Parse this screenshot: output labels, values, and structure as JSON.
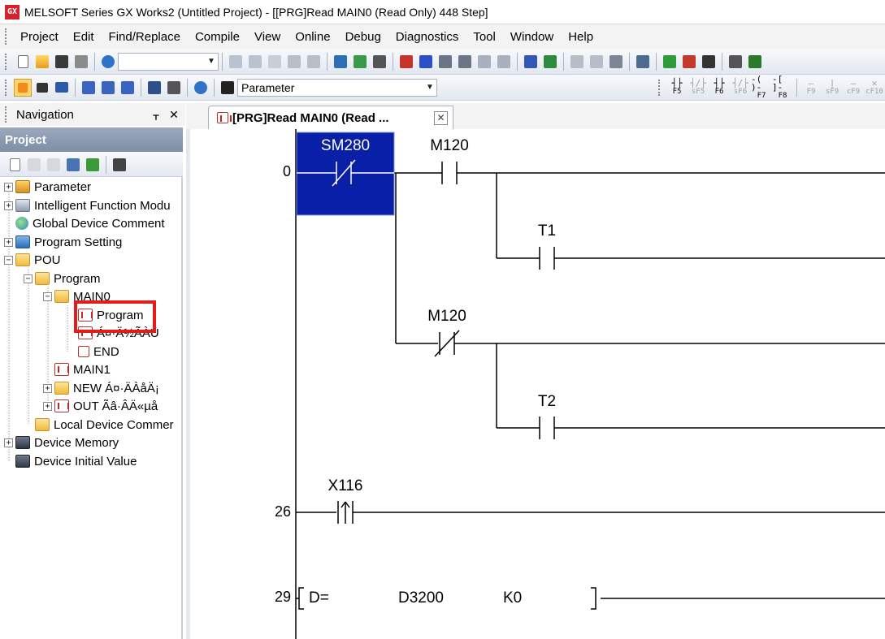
{
  "window": {
    "title": "MELSOFT Series GX Works2 (Untitled Project) - [[PRG]Read MAIN0 (Read Only) 448 Step]",
    "logo_text": "GX"
  },
  "menu": [
    {
      "label": "Project"
    },
    {
      "label": "Edit"
    },
    {
      "label": "Find/Replace"
    },
    {
      "label": "Compile"
    },
    {
      "label": "View"
    },
    {
      "label": "Online"
    },
    {
      "label": "Debug"
    },
    {
      "label": "Diagnostics"
    },
    {
      "label": "Tool"
    },
    {
      "label": "Window"
    },
    {
      "label": "Help"
    }
  ],
  "toolbar2": {
    "combo_value": "Parameter",
    "fkeys": [
      {
        "sym": "┤├",
        "key": "F5"
      },
      {
        "sym": "┤/├",
        "key": "sF5"
      },
      {
        "sym": "┤├",
        "key": "F6"
      },
      {
        "sym": "┤/├",
        "key": "sF6"
      },
      {
        "sym": "-( )-",
        "key": "F7"
      },
      {
        "sym": "-[ ]-",
        "key": "F8"
      },
      {
        "sym": "—",
        "key": "F9"
      },
      {
        "sym": "|",
        "key": "sF9"
      },
      {
        "sym": "—",
        "key": "cF9"
      },
      {
        "sym": "✕",
        "key": "cF10"
      }
    ]
  },
  "navigation": {
    "title": "Navigation",
    "pin_glyph": "ᚁ",
    "close_glyph": "✕",
    "project_header": "Project",
    "tree": [
      {
        "label": "Parameter",
        "level": 0,
        "expander": "+",
        "icon": "param"
      },
      {
        "label": "Intelligent Function Modu",
        "level": 0,
        "expander": "+",
        "icon": "intel"
      },
      {
        "label": "Global Device Comment",
        "level": 0,
        "expander": "",
        "icon": "globe"
      },
      {
        "label": "Program Setting",
        "level": 0,
        "expander": "+",
        "icon": "setting"
      },
      {
        "label": "POU",
        "level": 0,
        "expander": "−",
        "icon": "folder"
      },
      {
        "label": "Program",
        "level": 1,
        "expander": "−",
        "icon": "folder"
      },
      {
        "label": "MAIN0",
        "level": 2,
        "expander": "−",
        "icon": "prog"
      },
      {
        "label": "Program",
        "level": 3,
        "expander": "",
        "icon": "prog"
      },
      {
        "label": "Á¤·Ä½ÃÀÛ",
        "level": 3,
        "expander": "",
        "icon": "prog"
      },
      {
        "label": "END",
        "level": 3,
        "expander": "",
        "icon": "end"
      },
      {
        "label": "MAIN1",
        "level": 2,
        "expander": "",
        "icon": "prog"
      },
      {
        "label": "NEW Á¤·ÄÀåÄ¡",
        "level": 2,
        "expander": "+",
        "icon": "prog"
      },
      {
        "label": "OUT Ãâ·ÂÄ«µå",
        "level": 2,
        "expander": "+",
        "icon": "prog"
      },
      {
        "label": "Local Device Commer",
        "level": 1,
        "expander": "",
        "icon": "folder"
      },
      {
        "label": "Device Memory",
        "level": 0,
        "expander": "+",
        "icon": "mem"
      },
      {
        "label": "Device Initial Value",
        "level": 0,
        "expander": "",
        "icon": "mem"
      }
    ]
  },
  "editor": {
    "tab_label": "[PRG]Read MAIN0 (Read ...",
    "tab_close": "✕",
    "ladder": {
      "step_numbers": [
        "0",
        "26",
        "29"
      ],
      "contacts": [
        "SM280",
        "M120",
        "T1",
        "M120",
        "T2",
        "X116"
      ],
      "instruction": {
        "op": "D=",
        "arg1": "D3200",
        "arg2": "K0"
      }
    }
  },
  "colors": {
    "selection": "#0a1fa8",
    "highlight_box": "#e41b1b",
    "project_header": "#8a99b0"
  }
}
